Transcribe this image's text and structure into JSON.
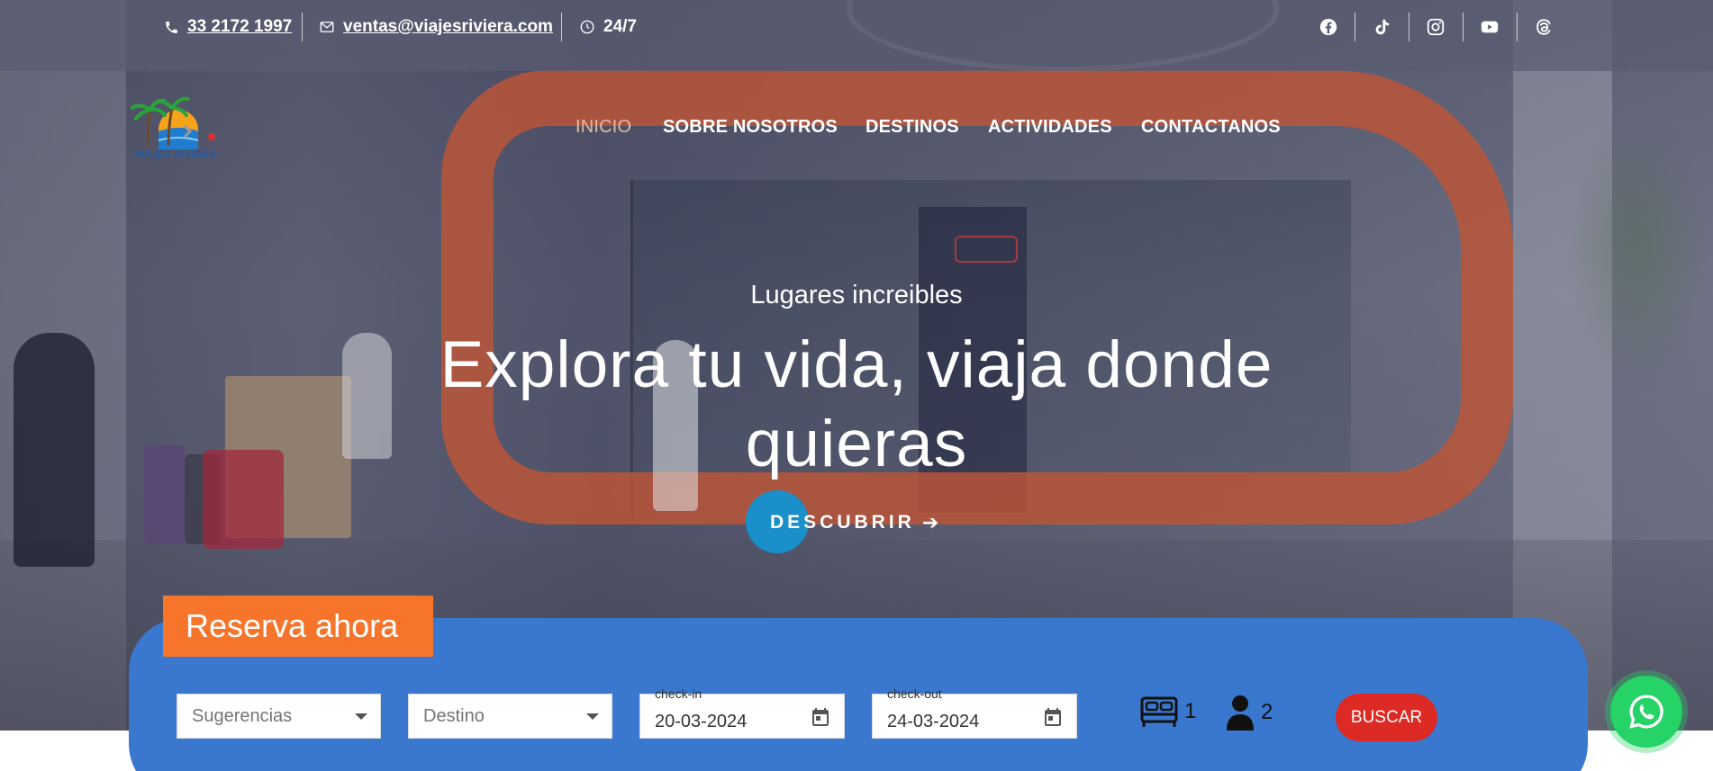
{
  "topbar": {
    "phone": "33 2172 1997",
    "email": "ventas@viajesriviera.com",
    "hours": "24/7",
    "social": [
      "facebook-icon",
      "tiktok-icon",
      "instagram-icon",
      "youtube-icon",
      "threads-icon"
    ]
  },
  "logo": {
    "text": "VIAJES RIVIERA"
  },
  "nav": {
    "items": [
      {
        "label": "INICIO",
        "active": true
      },
      {
        "label": "SOBRE NOSOTROS"
      },
      {
        "label": "DESTINOS"
      },
      {
        "label": "ACTIVIDADES"
      },
      {
        "label": "CONTACTANOS"
      }
    ]
  },
  "hero": {
    "subtitle": "Lugares increibles",
    "title": "Explora tu vida, viaja donde quieras",
    "cta": "DESCUBRIR"
  },
  "booking": {
    "tab_label": "Reserva ahora",
    "suggestions_placeholder": "Sugerencias",
    "destination_placeholder": "Destino",
    "checkin_label": "check-in",
    "checkin_value": "20-03-2024",
    "checkout_label": "check-out",
    "checkout_value": "24-03-2024",
    "rooms": "1",
    "guests": "2",
    "search_label": "BUSCAR"
  },
  "colors": {
    "booking_panel": "#3a78cf",
    "reserve_tab": "#f7752b",
    "search_button": "#dd2a24",
    "cta_circle": "#1a8fc9",
    "whatsapp": "#25d366",
    "nav_active": "#e9b8a2"
  }
}
